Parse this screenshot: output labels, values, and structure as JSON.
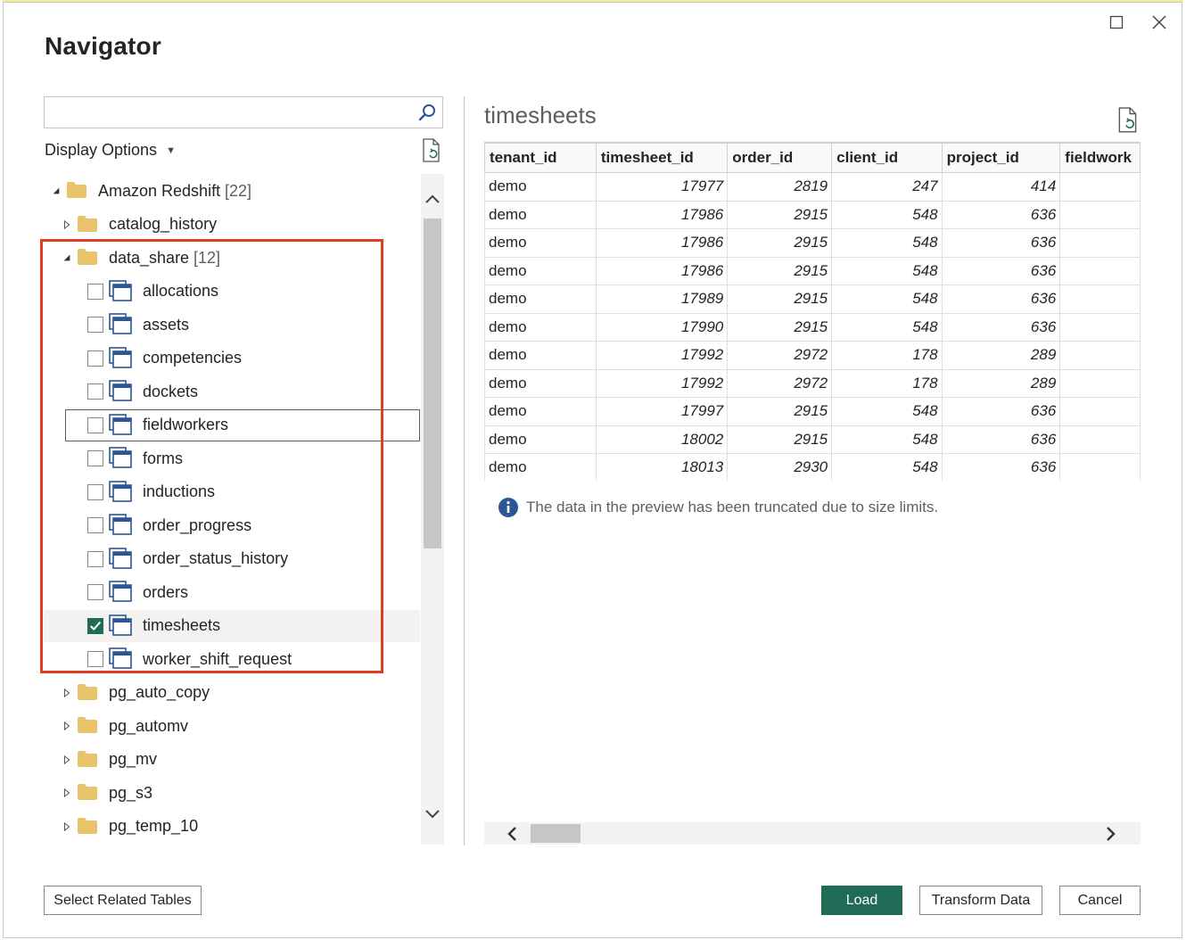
{
  "window": {
    "title": "Navigator"
  },
  "left_panel": {
    "search": {
      "value": "",
      "placeholder": ""
    },
    "display_options_label": "Display Options",
    "tree": {
      "root": {
        "label": "Amazon Redshift",
        "count": "[22]",
        "expanded": true
      },
      "items": [
        {
          "type": "folder",
          "label": "catalog_history",
          "count": "",
          "expanded": false
        },
        {
          "type": "folder",
          "label": "data_share",
          "count": "[12]",
          "expanded": true
        },
        {
          "type": "table",
          "label": "allocations",
          "checked": false
        },
        {
          "type": "table",
          "label": "assets",
          "checked": false
        },
        {
          "type": "table",
          "label": "competencies",
          "checked": false
        },
        {
          "type": "table",
          "label": "dockets",
          "checked": false
        },
        {
          "type": "table",
          "label": "fieldworkers",
          "checked": false
        },
        {
          "type": "table",
          "label": "forms",
          "checked": false
        },
        {
          "type": "table",
          "label": "inductions",
          "checked": false
        },
        {
          "type": "table",
          "label": "order_progress",
          "checked": false
        },
        {
          "type": "table",
          "label": "order_status_history",
          "checked": false
        },
        {
          "type": "table",
          "label": "orders",
          "checked": false
        },
        {
          "type": "table",
          "label": "timesheets",
          "checked": true
        },
        {
          "type": "table",
          "label": "worker_shift_request",
          "checked": false
        },
        {
          "type": "folder",
          "label": "pg_auto_copy",
          "count": "",
          "expanded": false
        },
        {
          "type": "folder",
          "label": "pg_automv",
          "count": "",
          "expanded": false
        },
        {
          "type": "folder",
          "label": "pg_mv",
          "count": "",
          "expanded": false
        },
        {
          "type": "folder",
          "label": "pg_s3",
          "count": "",
          "expanded": false
        },
        {
          "type": "folder",
          "label": "pg_temp_10",
          "count": "",
          "expanded": false
        }
      ]
    }
  },
  "preview": {
    "title": "timesheets",
    "columns": [
      "tenant_id",
      "timesheet_id",
      "order_id",
      "client_id",
      "project_id",
      "fieldwork"
    ],
    "rows": [
      [
        "demo",
        "17977",
        "2819",
        "247",
        "414",
        ""
      ],
      [
        "demo",
        "17986",
        "2915",
        "548",
        "636",
        ""
      ],
      [
        "demo",
        "17986",
        "2915",
        "548",
        "636",
        ""
      ],
      [
        "demo",
        "17986",
        "2915",
        "548",
        "636",
        ""
      ],
      [
        "demo",
        "17989",
        "2915",
        "548",
        "636",
        ""
      ],
      [
        "demo",
        "17990",
        "2915",
        "548",
        "636",
        ""
      ],
      [
        "demo",
        "17992",
        "2972",
        "178",
        "289",
        ""
      ],
      [
        "demo",
        "17992",
        "2972",
        "178",
        "289",
        ""
      ],
      [
        "demo",
        "17997",
        "2915",
        "548",
        "636",
        ""
      ],
      [
        "demo",
        "18002",
        "2915",
        "548",
        "636",
        ""
      ],
      [
        "demo",
        "18013",
        "2930",
        "548",
        "636",
        ""
      ]
    ],
    "truncation_note": "The data in the preview has been truncated due to size limits."
  },
  "buttons": {
    "select_related": "Select Related Tables",
    "load": "Load",
    "transform": "Transform Data",
    "cancel": "Cancel"
  },
  "colors": {
    "accent": "#1f6b56",
    "highlight_border": "#e03c22",
    "folder": "#e8c36a",
    "table_icon": "#2b5797",
    "info_icon": "#2b5797"
  }
}
